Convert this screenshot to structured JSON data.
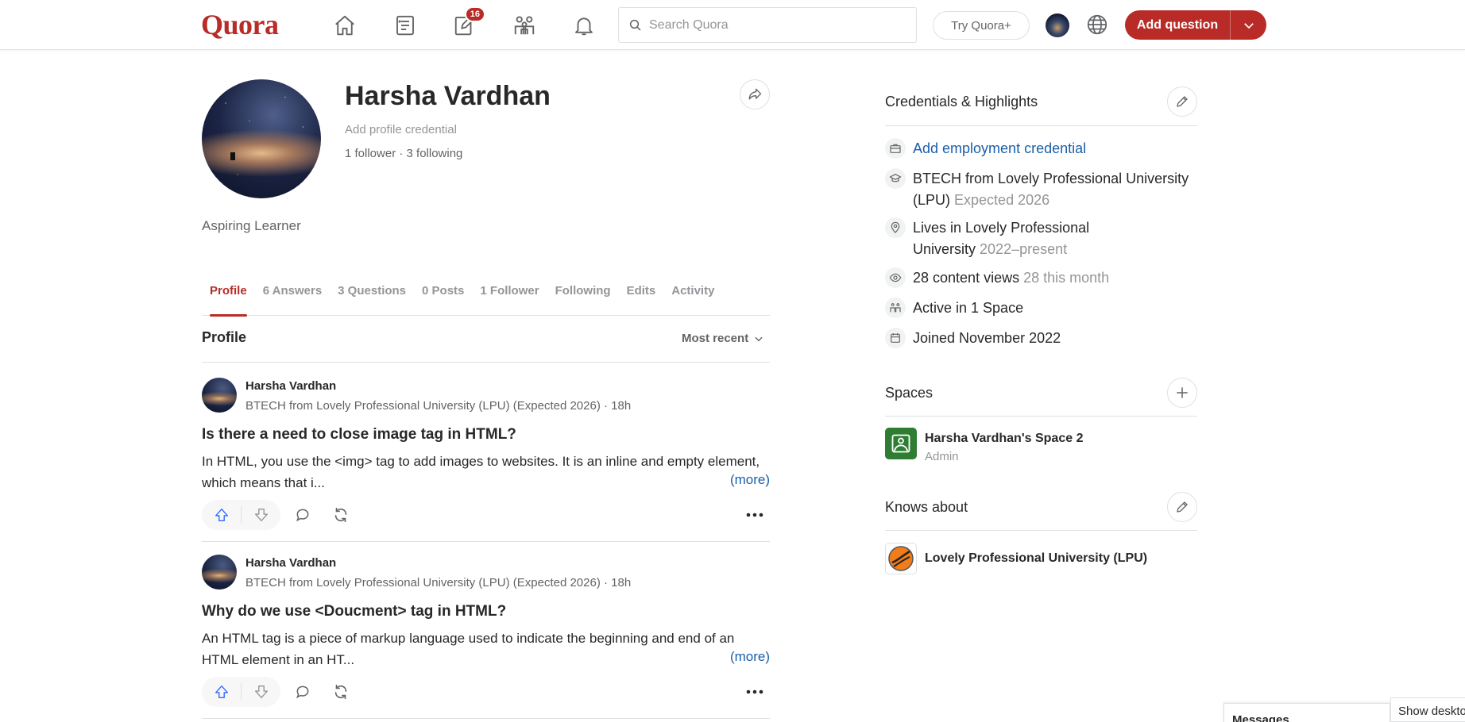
{
  "header": {
    "logo": "Quora",
    "notification_count": "16",
    "search_placeholder": "Search Quora",
    "try_label": "Try Quora+",
    "add_question_label": "Add question",
    "brand_color": "#b92b27"
  },
  "profile": {
    "name": "Harsha Vardhan",
    "add_credential": "Add profile credential",
    "follow_line": "1 follower · 3 following",
    "bio": "Aspiring Learner"
  },
  "tabs": [
    {
      "label": "Profile",
      "active": true
    },
    {
      "label": "6 Answers"
    },
    {
      "label": "3 Questions"
    },
    {
      "label": "0 Posts"
    },
    {
      "label": "1 Follower"
    },
    {
      "label": "Following"
    },
    {
      "label": "Edits"
    },
    {
      "label": "Activity"
    }
  ],
  "feed": {
    "section_title": "Profile",
    "sort_label": "Most recent",
    "items": [
      {
        "author": "Harsha Vardhan",
        "credential": "BTECH from Lovely Professional University (LPU) (Expected 2026) · 18h",
        "question": "Is there a need to close image tag in HTML?",
        "snippet": "In HTML, you use the <img> tag to add images to websites. It is an inline and empty element, which means that i...",
        "more": "(more)"
      },
      {
        "author": "Harsha Vardhan",
        "credential": "BTECH from Lovely Professional University (LPU) (Expected 2026) · 18h",
        "question": "Why do we use <Doucment> tag in HTML?",
        "snippet": "An HTML tag is a piece of markup language used to indicate the beginning and end of an HTML element in an HT...",
        "more": "(more)"
      }
    ]
  },
  "credentials": {
    "title": "Credentials & Highlights",
    "employment": "Add employment credential",
    "education": "BTECH from Lovely Professional University (LPU)",
    "education_muted": "Expected 2026",
    "location": "Lives in Lovely Professional University",
    "location_muted": "2022–present",
    "views": "28 content views",
    "views_muted": "28 this month",
    "spaces_active": "Active in 1 Space",
    "joined": "Joined November 2022"
  },
  "spaces": {
    "title": "Spaces",
    "items": [
      {
        "name": "Harsha Vardhan's Space 2",
        "role": "Admin"
      }
    ]
  },
  "knows_about": {
    "title": "Knows about",
    "items": [
      {
        "name": "Lovely Professional University (LPU)"
      }
    ]
  },
  "footer": {
    "messages": "Messages",
    "show_desktop": "Show desktop"
  }
}
